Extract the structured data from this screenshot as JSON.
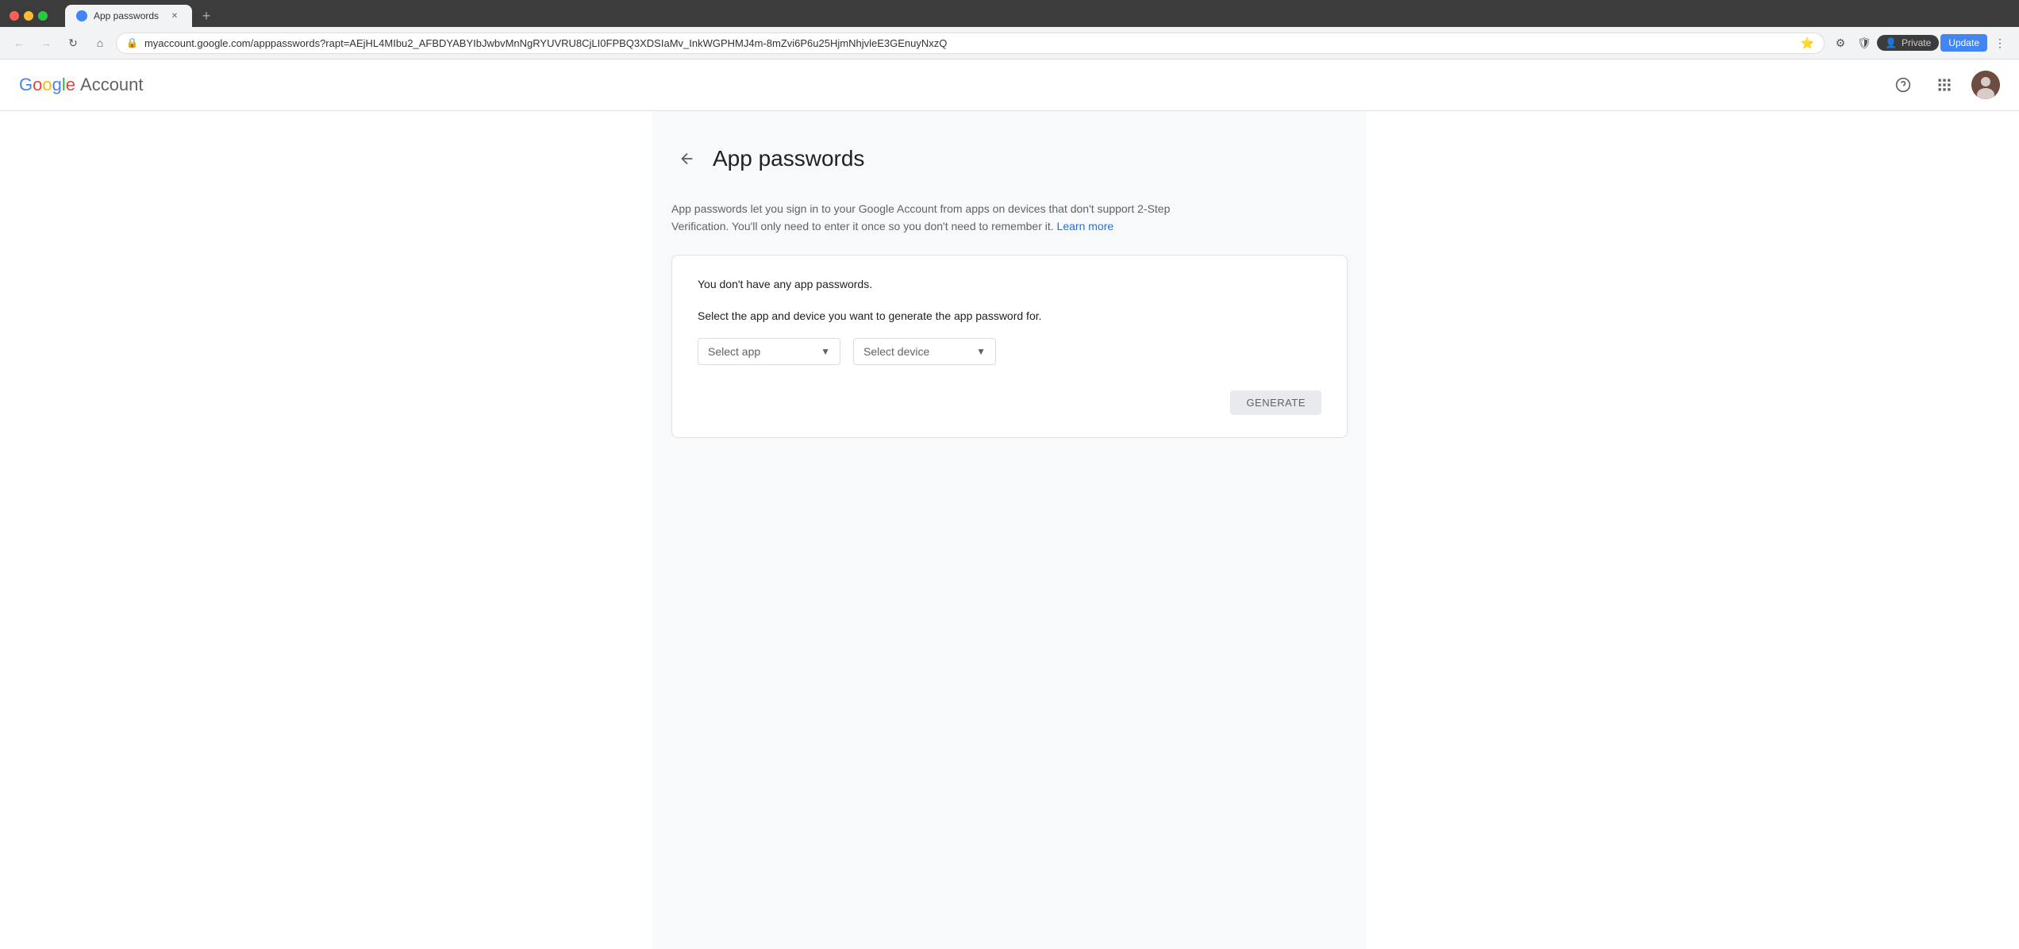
{
  "browser": {
    "tab": {
      "title": "App passwords",
      "favicon_label": "google-favicon"
    },
    "url": "myaccount.google.com/apppasswords?rapt=AEjHL4MIbu2_AFBDYABYIbJwbvMnNgRYUVRU8CjLI0FPBQ3XDSIaMv_InkWGPHMJ4m-8mZvi6P6u25HjmNhjvleE3GEnuyNxzQ",
    "private_label": "Private",
    "update_label": "Update"
  },
  "header": {
    "logo_text": "Google",
    "account_text": "Account",
    "help_icon": "help-circle-icon",
    "apps_icon": "grid-icon",
    "avatar_icon": "user-avatar-icon"
  },
  "page": {
    "back_icon": "back-arrow-icon",
    "title": "App passwords",
    "description_part1": "App passwords let you sign in to your Google Account from apps on devices that don't support 2-Step Verification. You'll only need to enter it once so you don't need to remember it.",
    "learn_more_text": "Learn more",
    "no_passwords_text": "You don't have any app passwords.",
    "select_prompt": "Select the app and device you want to generate the app password for.",
    "select_app_label": "Select app",
    "select_device_label": "Select device",
    "generate_button_label": "GENERATE"
  }
}
